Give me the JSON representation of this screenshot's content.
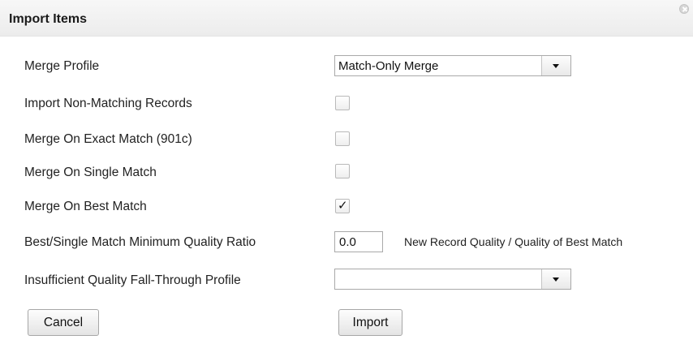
{
  "dialog": {
    "title": "Import Items",
    "close_icon": "close-icon"
  },
  "form": {
    "merge_profile": {
      "label": "Merge Profile",
      "selected": "Match-Only Merge"
    },
    "import_non_matching": {
      "label": "Import Non-Matching Records",
      "checked": false
    },
    "merge_exact": {
      "label": "Merge On Exact Match (901c)",
      "checked": false
    },
    "merge_single": {
      "label": "Merge On Single Match",
      "checked": false
    },
    "merge_best": {
      "label": "Merge On Best Match",
      "checked": true,
      "check_glyph": "✓"
    },
    "quality_ratio": {
      "label": "Best/Single Match Minimum Quality Ratio",
      "value": "0.0",
      "hint": "New Record Quality / Quality of Best Match"
    },
    "fallthrough_profile": {
      "label": "Insufficient Quality Fall-Through Profile",
      "selected": ""
    }
  },
  "buttons": {
    "cancel": "Cancel",
    "import": "Import"
  }
}
